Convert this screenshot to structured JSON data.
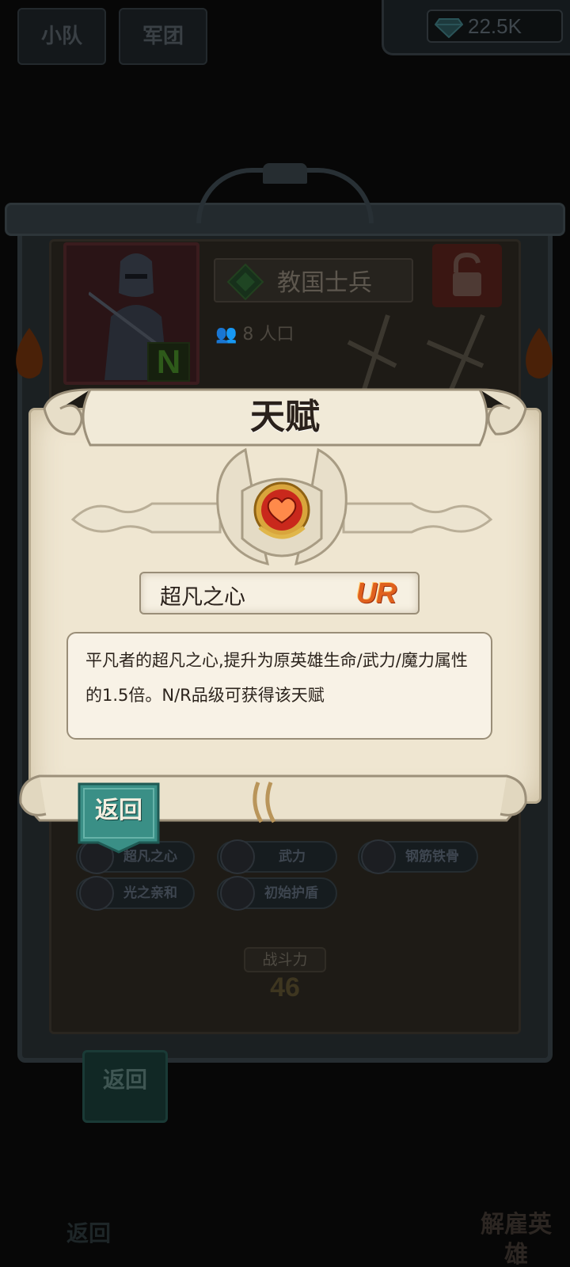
{
  "background": {
    "tabs": [
      "小队",
      "军团"
    ],
    "gems": "22.5K",
    "unit": {
      "name": "教国士兵",
      "rarity": "N",
      "population": "8 人口"
    },
    "talent_chips": [
      "超凡之心",
      "武力",
      "钢筋铁骨",
      "光之亲和",
      "初始护盾"
    ],
    "power_label": "战斗力",
    "power_value": "46",
    "back_label": "返回",
    "bottom_back": "返回",
    "dismiss_label": "解雇英雄"
  },
  "modal": {
    "title": "天赋",
    "talent_name": "超凡之心",
    "talent_grade": "UR",
    "description": "平凡者的超凡之心,提升为原英雄生命/武力/魔力属性的1.5倍。N/R品级可获得该天赋",
    "back_label": "返回"
  },
  "colors": {
    "parchment": "#efe6d1",
    "grade_orange": "#e0611e",
    "back_teal": "#3a8f86"
  },
  "icons": [
    "gem-icon",
    "lock-icon",
    "population-icon",
    "swords-icon",
    "torch-icon",
    "heart-emblem-icon",
    "wings-icon"
  ]
}
